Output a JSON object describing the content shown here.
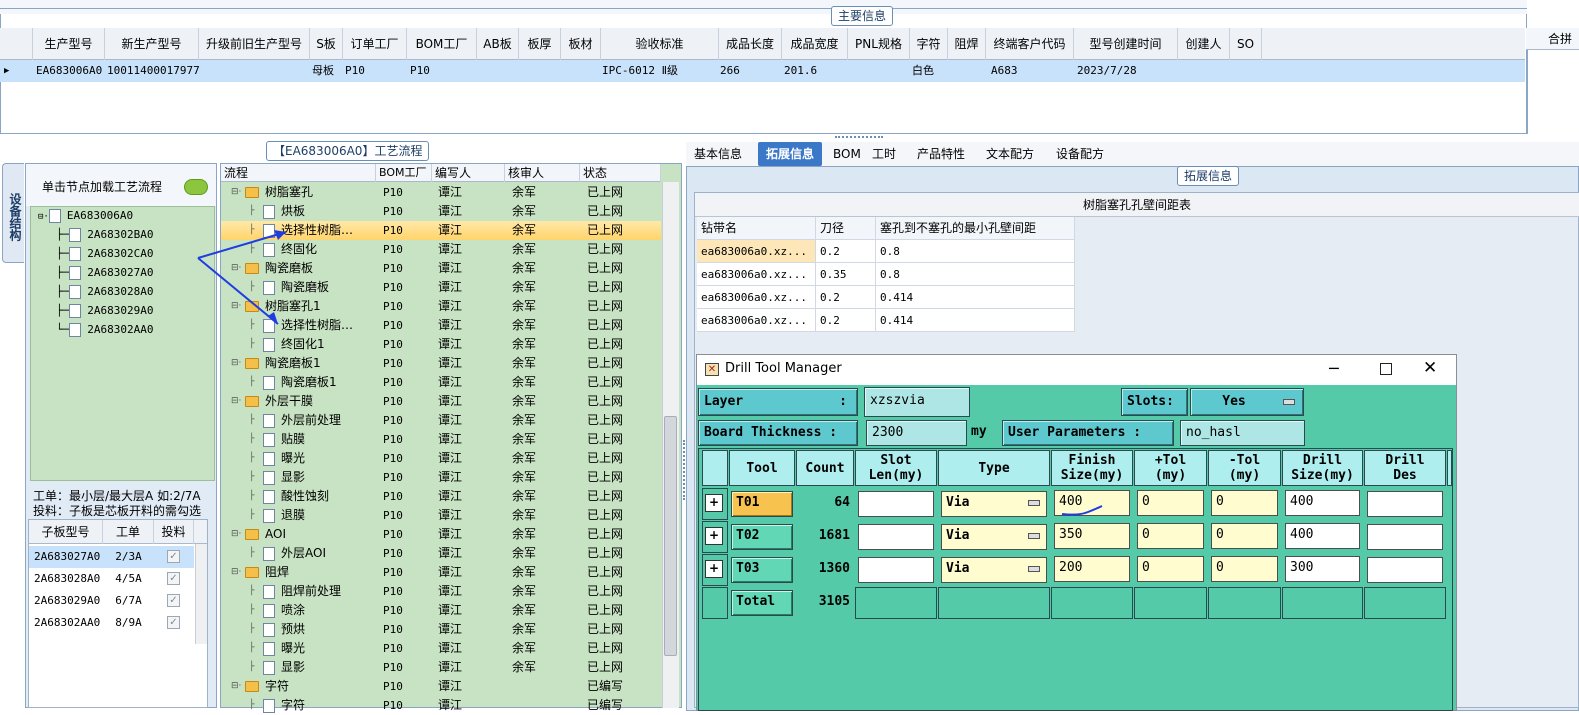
{
  "top": {
    "title": "主要信息",
    "columns": [
      "生产型号",
      "新生产型号",
      "升级前旧生产型号",
      "S板",
      "订单工厂",
      "BOM工厂",
      "AB板",
      "板厚",
      "板材",
      "验收标准",
      "成品长度",
      "成品宽度",
      "PNL规格",
      "字符",
      "阻焊",
      "终端客户代码",
      "型号创建时间",
      "创建人",
      "SO"
    ],
    "row": {
      "model": "EA683006A0",
      "new_model": "10011400017977",
      "s_board": "母板",
      "order_factory": "P10",
      "bom_factory": "P10",
      "standard": "IPC-6012 Ⅱ级",
      "length": "266",
      "width": "201.6",
      "char": "白色",
      "customer_code": "A683",
      "created": "2023/7/28"
    },
    "right_partial": "合拼"
  },
  "left": {
    "side_tab": "设备结构",
    "hint": "单击节点加载工艺流程",
    "tree_root": "EA683006A0",
    "tree_children": [
      "2A68302BA0",
      "2A68302CA0",
      "2A683027A0",
      "2A683028A0",
      "2A683029A0",
      "2A68302AA0"
    ],
    "info_line1": "工单：最小层/最大层A 如:2/7A",
    "info_line2": "投料：子板是芯板开料的需勾选",
    "sub_headers": [
      "子板型号",
      "工单",
      "投料"
    ],
    "sub_rows": [
      {
        "model": "2A683027A0",
        "order": "2/3A"
      },
      {
        "model": "2A683028A0",
        "order": "4/5A"
      },
      {
        "model": "2A683029A0",
        "order": "6/7A"
      },
      {
        "model": "2A68302AA0",
        "order": "8/9A"
      }
    ]
  },
  "process": {
    "title": "【EA683006A0】工艺流程",
    "headers": [
      "流程",
      "BOM工厂",
      "编写人",
      "核审人",
      "状态"
    ],
    "rows": [
      {
        "name": "树脂塞孔",
        "type": "folder",
        "level": 1,
        "bom": "P10",
        "writer": "谭江",
        "reviewer": "余军",
        "status": "已上网"
      },
      {
        "name": "烘板",
        "type": "file",
        "level": 2,
        "bom": "P10",
        "writer": "谭江",
        "reviewer": "余军",
        "status": "已上网"
      },
      {
        "name": "选择性树脂…",
        "type": "file",
        "level": 2,
        "bom": "P10",
        "writer": "谭江",
        "reviewer": "余军",
        "status": "已上网",
        "selected": true
      },
      {
        "name": "终固化",
        "type": "file",
        "level": 2,
        "bom": "P10",
        "writer": "谭江",
        "reviewer": "余军",
        "status": "已上网"
      },
      {
        "name": "陶瓷磨板",
        "type": "folder",
        "level": 1,
        "bom": "P10",
        "writer": "谭江",
        "reviewer": "余军",
        "status": "已上网"
      },
      {
        "name": "陶瓷磨板",
        "type": "file",
        "level": 2,
        "bom": "P10",
        "writer": "谭江",
        "reviewer": "余军",
        "status": "已上网"
      },
      {
        "name": "树脂塞孔1",
        "type": "folder",
        "level": 1,
        "bom": "P10",
        "writer": "谭江",
        "reviewer": "余军",
        "status": "已上网"
      },
      {
        "name": "选择性树脂…",
        "type": "file",
        "level": 2,
        "bom": "P10",
        "writer": "谭江",
        "reviewer": "余军",
        "status": "已上网"
      },
      {
        "name": "终固化1",
        "type": "file",
        "level": 2,
        "bom": "P10",
        "writer": "谭江",
        "reviewer": "余军",
        "status": "已上网"
      },
      {
        "name": "陶瓷磨板1",
        "type": "folder",
        "level": 1,
        "bom": "P10",
        "writer": "谭江",
        "reviewer": "余军",
        "status": "已上网"
      },
      {
        "name": "陶瓷磨板1",
        "type": "file",
        "level": 2,
        "bom": "P10",
        "writer": "谭江",
        "reviewer": "余军",
        "status": "已上网"
      },
      {
        "name": "外层干膜",
        "type": "folder",
        "level": 1,
        "bom": "P10",
        "writer": "谭江",
        "reviewer": "余军",
        "status": "已上网"
      },
      {
        "name": "外层前处理",
        "type": "file",
        "level": 2,
        "bom": "P10",
        "writer": "谭江",
        "reviewer": "余军",
        "status": "已上网"
      },
      {
        "name": "贴膜",
        "type": "file",
        "level": 2,
        "bom": "P10",
        "writer": "谭江",
        "reviewer": "余军",
        "status": "已上网"
      },
      {
        "name": "曝光",
        "type": "file",
        "level": 2,
        "bom": "P10",
        "writer": "谭江",
        "reviewer": "余军",
        "status": "已上网"
      },
      {
        "name": "显影",
        "type": "file",
        "level": 2,
        "bom": "P10",
        "writer": "谭江",
        "reviewer": "余军",
        "status": "已上网"
      },
      {
        "name": "酸性蚀刻",
        "type": "file",
        "level": 2,
        "bom": "P10",
        "writer": "谭江",
        "reviewer": "余军",
        "status": "已上网"
      },
      {
        "name": "退膜",
        "type": "file",
        "level": 2,
        "bom": "P10",
        "writer": "谭江",
        "reviewer": "余军",
        "status": "已上网"
      },
      {
        "name": "AOI",
        "type": "folder",
        "level": 1,
        "bom": "P10",
        "writer": "谭江",
        "reviewer": "余军",
        "status": "已上网"
      },
      {
        "name": "外层AOI",
        "type": "file",
        "level": 2,
        "bom": "P10",
        "writer": "谭江",
        "reviewer": "余军",
        "status": "已上网"
      },
      {
        "name": "阻焊",
        "type": "folder",
        "level": 1,
        "bom": "P10",
        "writer": "谭江",
        "reviewer": "余军",
        "status": "已上网"
      },
      {
        "name": "阻焊前处理",
        "type": "file",
        "level": 2,
        "bom": "P10",
        "writer": "谭江",
        "reviewer": "余军",
        "status": "已上网"
      },
      {
        "name": "喷涂",
        "type": "file",
        "level": 2,
        "bom": "P10",
        "writer": "谭江",
        "reviewer": "余军",
        "status": "已上网"
      },
      {
        "name": "预烘",
        "type": "file",
        "level": 2,
        "bom": "P10",
        "writer": "谭江",
        "reviewer": "余军",
        "status": "已上网"
      },
      {
        "name": "曝光",
        "type": "file",
        "level": 2,
        "bom": "P10",
        "writer": "谭江",
        "reviewer": "余军",
        "status": "已上网"
      },
      {
        "name": "显影",
        "type": "file",
        "level": 2,
        "bom": "P10",
        "writer": "谭江",
        "reviewer": "余军",
        "status": "已上网"
      },
      {
        "name": "字符",
        "type": "folder",
        "level": 1,
        "bom": "P10",
        "writer": "谭江",
        "reviewer": "",
        "status": "已编写"
      },
      {
        "name": "字符",
        "type": "file",
        "level": 2,
        "bom": "P10",
        "writer": "谭江",
        "reviewer": "",
        "status": "已编写"
      }
    ]
  },
  "right": {
    "tabs": [
      "基本信息",
      "拓展信息",
      "BOM",
      "工时",
      "产品特性",
      "文本配方",
      "设备配方"
    ],
    "active_tab": 1,
    "ext_title": "拓展信息",
    "table_title": "树脂塞孔孔壁间距表",
    "ext_headers": [
      "钻带名",
      "刀径",
      "塞孔到不塞孔的最小孔壁间距"
    ],
    "ext_rows": [
      [
        "ea683006a0.xz...",
        "0.2",
        "0.8"
      ],
      [
        "ea683006a0.xz...",
        "0.35",
        "0.8"
      ],
      [
        "ea683006a0.xz...",
        "0.2",
        "0.414"
      ],
      [
        "ea683006a0.xz...",
        "0.2",
        "0.414"
      ]
    ]
  },
  "dtm": {
    "title": "Drill Tool Manager",
    "layer_label": "Layer",
    "layer_colon": ":",
    "layer_value": "xzszvia",
    "slots_label": "Slots:",
    "slots_value": "Yes",
    "thickness_label": "Board Thickness :",
    "thickness_value": "2300",
    "thickness_unit": "my",
    "user_params_label": "User Parameters :",
    "user_params_value": "no_hasl",
    "headers": [
      "Tool",
      "Count",
      "Slot\nLen(my)",
      "Type",
      "Finish\nSize(my)",
      "+Tol\n(my)",
      "-Tol\n(my)",
      "Drill\nSize(my)",
      "Drill\nDes"
    ],
    "rows": [
      {
        "tool": "T01",
        "count": "64",
        "type": "Via",
        "finish": "400",
        "ptol": "0",
        "ntol": "0",
        "drill": "400"
      },
      {
        "tool": "T02",
        "count": "1681",
        "type": "Via",
        "finish": "350",
        "ptol": "0",
        "ntol": "0",
        "drill": "400"
      },
      {
        "tool": "T03",
        "count": "1360",
        "type": "Via",
        "finish": "200",
        "ptol": "0",
        "ntol": "0",
        "drill": "300"
      }
    ],
    "total_label": "Total",
    "total_count": "3105"
  }
}
